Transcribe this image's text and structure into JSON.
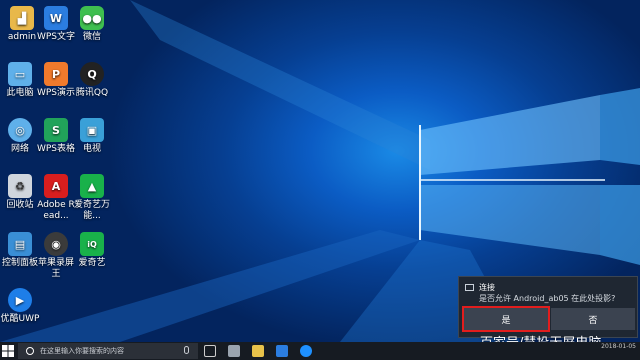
{
  "desktop_icons": [
    {
      "label": "admin",
      "icon": "user-folder-icon",
      "color": "#e8b84a"
    },
    {
      "label": "WPS文字",
      "icon": "wps-writer-icon",
      "color": "#2b7de0"
    },
    {
      "label": "微信",
      "icon": "wechat-icon",
      "color": "#3fbf4f"
    },
    {
      "label": "此电脑",
      "icon": "this-pc-icon",
      "color": "#5fb0ea"
    },
    {
      "label": "WPS演示",
      "icon": "wps-presentation-icon",
      "color": "#f07a2c"
    },
    {
      "label": "腾讯QQ",
      "icon": "qq-icon",
      "color": "#222222"
    },
    {
      "label": "网络",
      "icon": "network-icon",
      "color": "#5fb0ea"
    },
    {
      "label": "WPS表格",
      "icon": "wps-spreadsheet-icon",
      "color": "#21a35a"
    },
    {
      "label": "电视",
      "icon": "tv-icon",
      "color": "#3aa0d8"
    },
    {
      "label": "回收站",
      "icon": "recycle-bin-icon",
      "color": "#d0d6dd"
    },
    {
      "label": "Adobe Read...",
      "icon": "adobe-reader-icon",
      "color": "#d81e1e"
    },
    {
      "label": "爱奇艺万能...",
      "icon": "iqiyi-player-icon",
      "color": "#19b14a"
    },
    {
      "label": "控制面板",
      "icon": "control-panel-icon",
      "color": "#3a8fd6"
    },
    {
      "label": "苹果录屏王",
      "icon": "screen-recorder-icon",
      "color": "#3b3b3b"
    },
    {
      "label": "爱奇艺",
      "icon": "iqiyi-icon",
      "color": "#19b14a"
    },
    {
      "label": "优酷UWP",
      "icon": "youku-icon",
      "color": "#1e7ee8"
    }
  ],
  "toast": {
    "title": "连接",
    "body": "是否允许 Android_ab05 在此处投影?",
    "yes_label": "是",
    "no_label": "否",
    "highlight_color": "#e21d1d"
  },
  "watermark": "百家号/慧投无屏电脑",
  "taskbar": {
    "search_placeholder": "在这里输入你要搜索的内容",
    "date": "2018-01-05"
  }
}
